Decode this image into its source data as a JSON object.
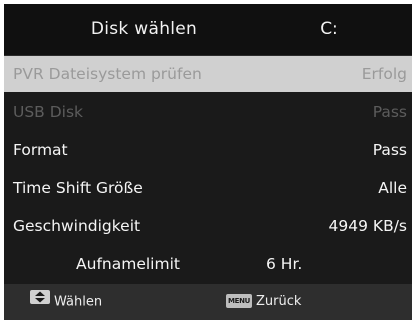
{
  "header": {
    "title": "Disk wählen",
    "drive": "C:"
  },
  "rows": [
    {
      "label": "PVR Dateisystem prüfen",
      "value": "Erfolg",
      "state": "selected"
    },
    {
      "label": "USB Disk",
      "value": "Pass",
      "state": "disabled"
    },
    {
      "label": "Format",
      "value": "Pass",
      "state": "normal"
    },
    {
      "label": "Time Shift Größe",
      "value": "Alle",
      "state": "normal"
    },
    {
      "label": "Geschwindigkeit",
      "value": "4949 KB/s",
      "state": "normal"
    },
    {
      "label": "Aufnamelimit",
      "value": "6 Hr.",
      "state": "normal"
    }
  ],
  "footer": {
    "select_icon": "up-down-arrow-icon",
    "select_label": "Wählen",
    "back_icon": "menu-key-icon",
    "back_key_text": "MENU",
    "back_label": "Zurück"
  },
  "colors": {
    "background": "#1a1a1a",
    "header": "#101010",
    "highlight": "#d0d0d0",
    "footer": "#2e2e2e",
    "text": "#f5f5f5",
    "disabled_text": "#5c5c5c",
    "highlight_text": "#9a9a9a"
  }
}
